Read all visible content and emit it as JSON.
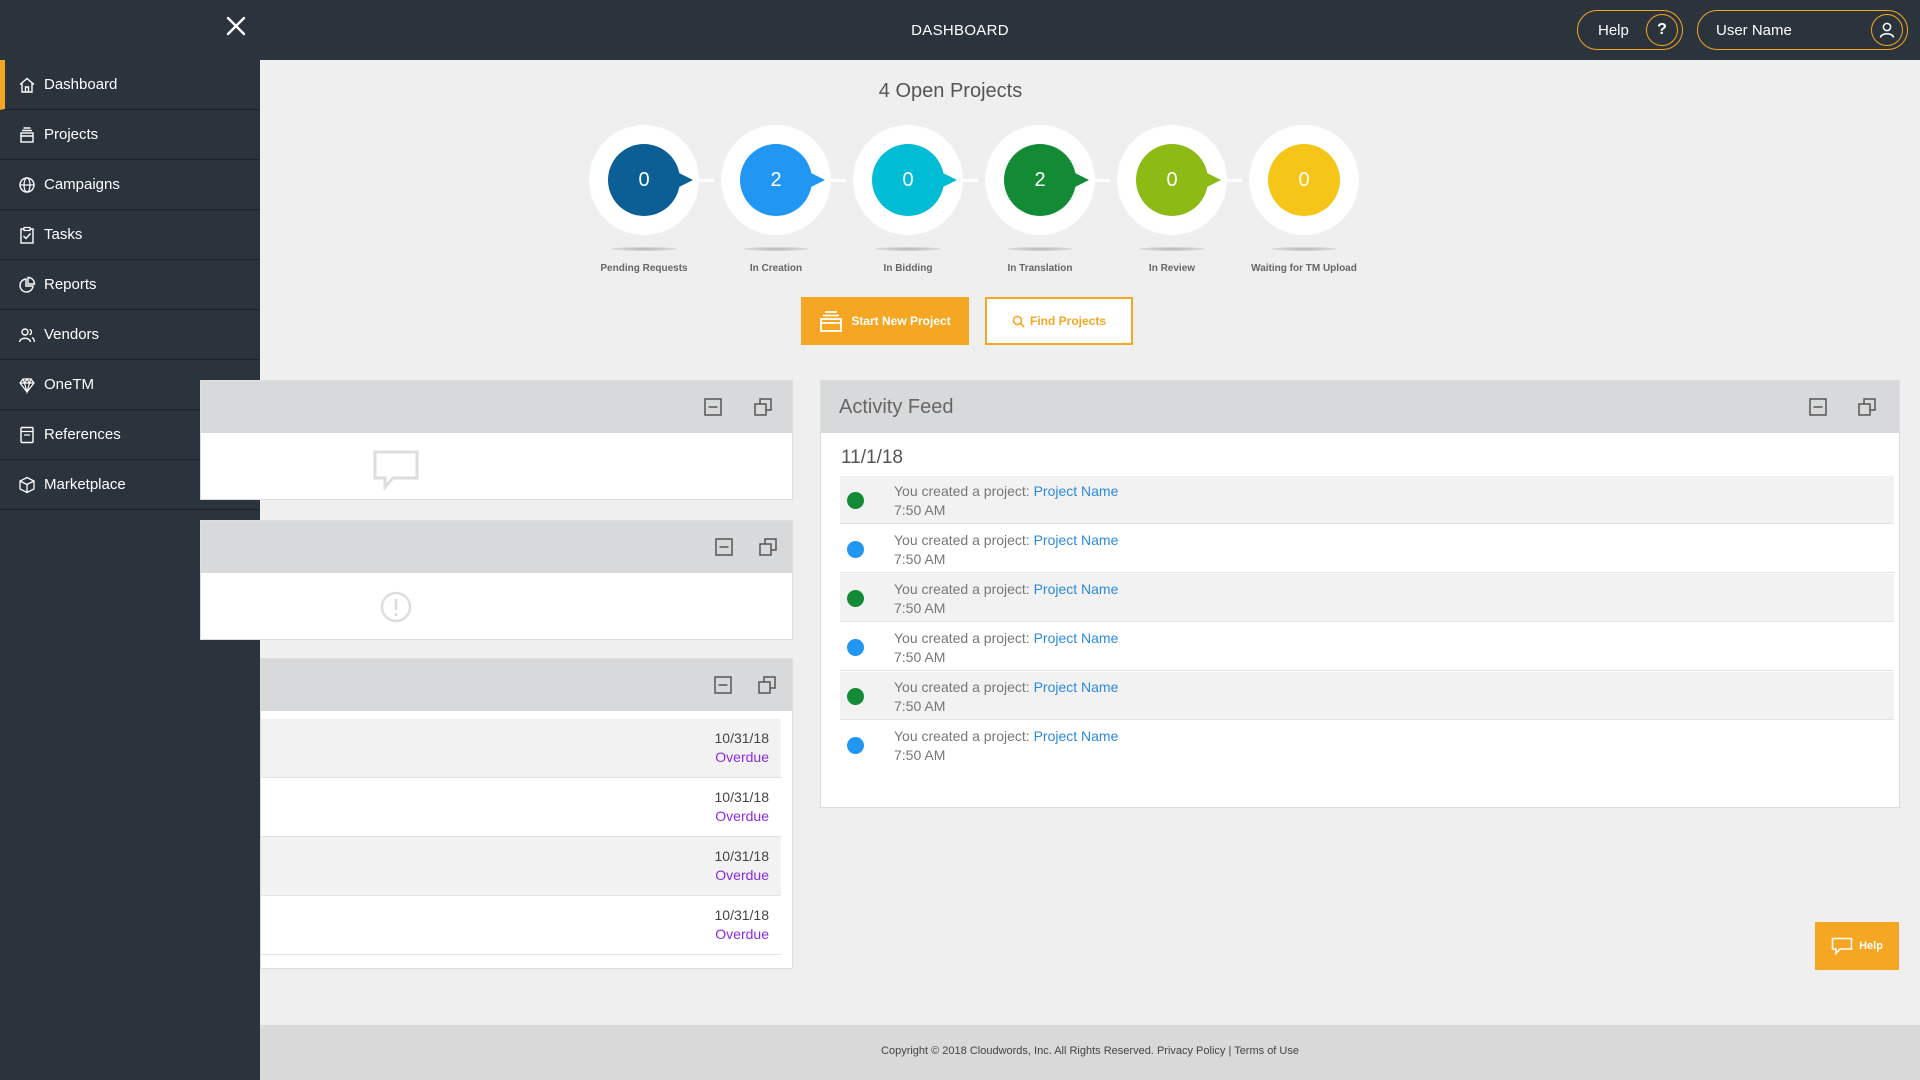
{
  "header": {
    "title": "DASHBOARD",
    "help_label": "Help",
    "help_icon_glyph": "?",
    "user_label": "User Name"
  },
  "sidebar": {
    "items": [
      {
        "label": "Dashboard",
        "icon": "home-icon",
        "active": true
      },
      {
        "label": "Projects",
        "icon": "projects-icon"
      },
      {
        "label": "Campaigns",
        "icon": "globe-icon"
      },
      {
        "label": "Tasks",
        "icon": "clipboard-icon"
      },
      {
        "label": "Reports",
        "icon": "pie-chart-icon"
      },
      {
        "label": "Vendors",
        "icon": "people-icon"
      },
      {
        "label": "OneTM",
        "icon": "diamond-icon"
      },
      {
        "label": "References",
        "icon": "book-icon"
      },
      {
        "label": "Marketplace",
        "icon": "box-icon"
      }
    ]
  },
  "summary": {
    "title": "4 Open Projects",
    "stages": [
      {
        "label": "Pending Requests",
        "count": "0",
        "color": "#0b5f95"
      },
      {
        "label": "In Creation",
        "count": "2",
        "color": "#2196f3"
      },
      {
        "label": "In Bidding",
        "count": "0",
        "color": "#00bcd4"
      },
      {
        "label": "In Translation",
        "count": "2",
        "color": "#138a36"
      },
      {
        "label": "In Review",
        "count": "0",
        "color": "#8dba14"
      },
      {
        "label": "Waiting for TM Upload",
        "count": "0",
        "color": "#f5c518"
      }
    ]
  },
  "actions": {
    "start_label": "Start New Project",
    "find_label": "Find Projects"
  },
  "activity_feed": {
    "title": "Activity Feed",
    "date": "11/1/18",
    "entries": [
      {
        "text": "You created a project: ",
        "link": "Project Name",
        "time": "7:50 AM",
        "color": "#138a36"
      },
      {
        "text": "You created a project: ",
        "link": "Project Name",
        "time": "7:50 AM",
        "color": "#2196f3"
      },
      {
        "text": "You created a project: ",
        "link": "Project Name",
        "time": "7:50 AM",
        "color": "#138a36"
      },
      {
        "text": "You created a project: ",
        "link": "Project Name",
        "time": "7:50 AM",
        "color": "#2196f3"
      },
      {
        "text": "You created a project: ",
        "link": "Project Name",
        "time": "7:50 AM",
        "color": "#138a36"
      },
      {
        "text": "You created a project: ",
        "link": "Project Name",
        "time": "7:50 AM",
        "color": "#2196f3"
      }
    ]
  },
  "tasks_panel": {
    "rows": [
      {
        "date": "10/31/18",
        "status": "Overdue"
      },
      {
        "date": "10/31/18",
        "status": "Overdue"
      },
      {
        "date": "10/31/18",
        "status": "Overdue"
      },
      {
        "date": "10/31/18",
        "status": "Overdue"
      }
    ]
  },
  "footer": {
    "copyright": "Copyright © 2018 Cloudwords, Inc. All Rights Reserved.",
    "privacy": "Privacy Policy",
    "separator": "|",
    "terms": "Terms of Use"
  },
  "help_widget": {
    "label": "Help"
  },
  "colors": {
    "accent": "#f5a623",
    "nav_bg": "#2b333d",
    "link": "#2a8adf",
    "overdue": "#8a2be2"
  }
}
